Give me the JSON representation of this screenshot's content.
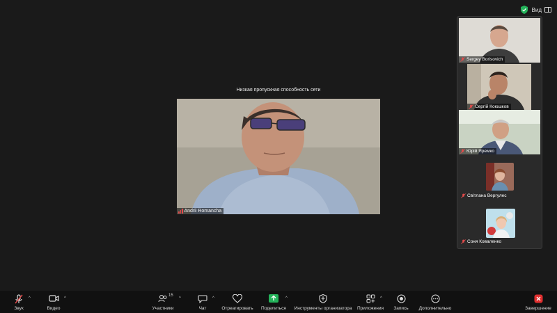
{
  "topbar": {
    "view_label": "Вид"
  },
  "main": {
    "notice": "Низкая пропускная способность сети",
    "speaker_name": "Andrii Romancha"
  },
  "gallery": [
    {
      "name": "Sergey Borisovich"
    },
    {
      "name": "Сергій Коюшков"
    },
    {
      "name": "Юрій Яремко"
    },
    {
      "name": "Світлана Вергулес"
    },
    {
      "name": "Соня Коваленко"
    }
  ],
  "toolbar": {
    "audio": "Звук",
    "video": "Видео",
    "participants": "Участники",
    "participants_count": "15",
    "chat": "Чат",
    "react": "Отреагировать",
    "share": "Поделиться",
    "host_tools": "Инструменты организатора",
    "apps": "Приложения",
    "record": "Запись",
    "more": "Дополнительно",
    "end": "Завершение"
  },
  "colors": {
    "accent_green": "#24b35a",
    "end_red": "#e02f2f",
    "mute_red": "#e34b4b"
  }
}
